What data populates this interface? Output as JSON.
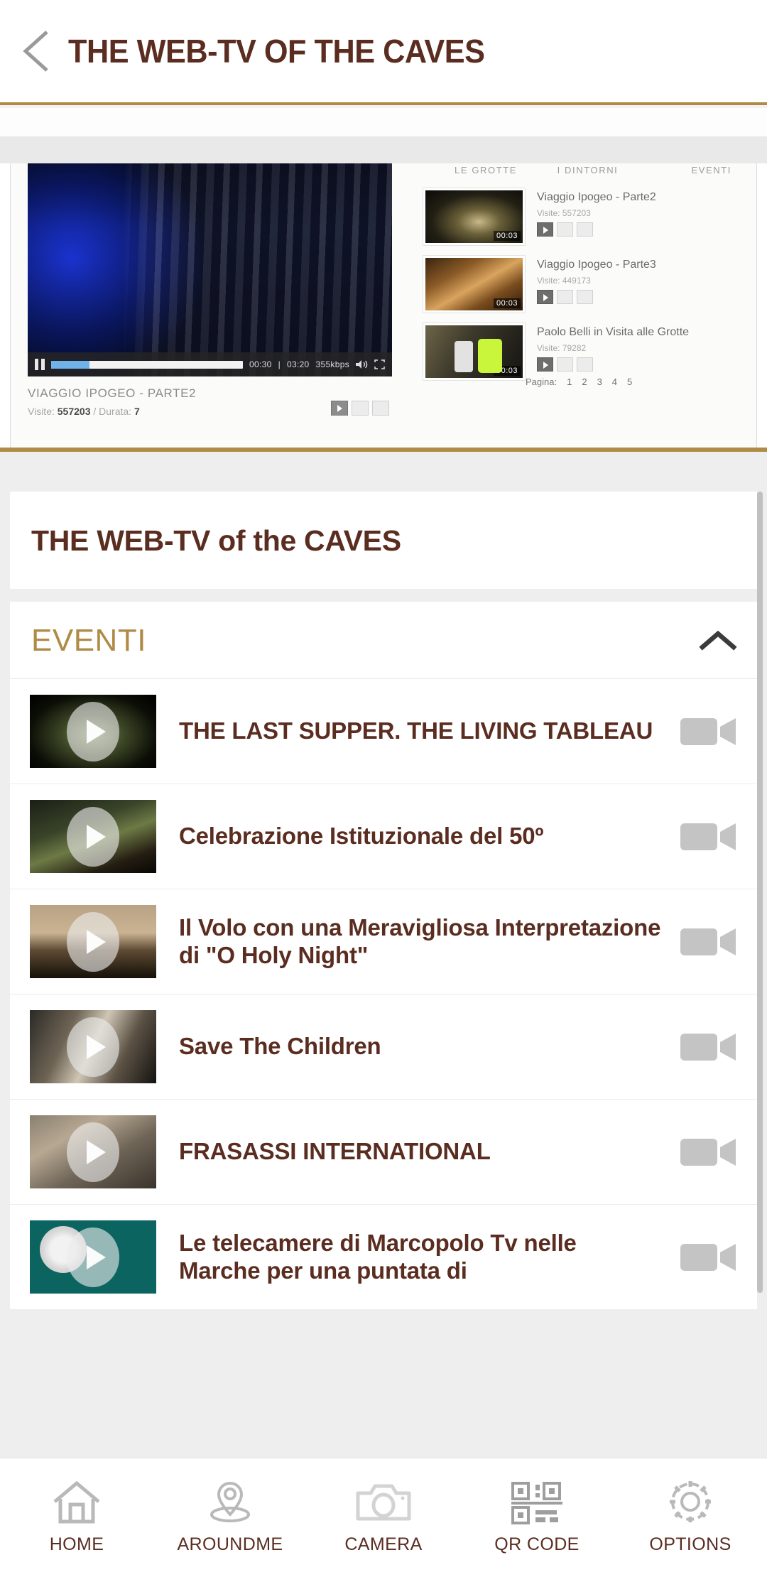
{
  "header": {
    "back_icon": "chevron-left-icon",
    "title": "THE WEB-TV OF THE CAVES"
  },
  "webview": {
    "player": {
      "pause_icon": "pause-icon",
      "time_current": "00:30",
      "time_separator": "|",
      "time_total": "03:20",
      "bitrate": "355kbps",
      "volume_icon": "volume-icon",
      "fullscreen_icon": "fullscreen-icon",
      "caption_title": "VIAGGIO IPOGEO - PARTE2",
      "caption_visits_label": "Visite:",
      "caption_visits_value": "557203",
      "caption_sep": "/",
      "caption_duration_label": "Durata:",
      "caption_duration_value": "7"
    },
    "tabs": [
      "LE GROTTE",
      "I DINTORNI",
      "EVENTI"
    ],
    "playlist": [
      {
        "title": "Viaggio Ipogeo - Parte2",
        "visits": "Visite: 557203",
        "duration": "00:03"
      },
      {
        "title": "Viaggio Ipogeo - Parte3",
        "visits": "Visite: 449173",
        "duration": "00:03"
      },
      {
        "title": "Paolo Belli in Visita alle Grotte",
        "visits": "Visite: 79282",
        "duration": "00:03"
      }
    ],
    "pager_label": "Pagina:",
    "pager_pages": [
      "1",
      "2",
      "3",
      "4",
      "5"
    ]
  },
  "collapse_tab": {
    "icon": "chevron-up-icon"
  },
  "section": {
    "card_title": "THE WEB-TV of the CAVES",
    "accordion_title": "EVENTI",
    "accordion_chevron": "chevron-up-icon"
  },
  "videos": [
    {
      "title": "THE LAST SUPPER. THE LIVING TABLEAU",
      "play_icon": "play-icon",
      "action_icon": "video-camera-icon"
    },
    {
      "title": "Celebrazione Istituzionale del 50º",
      "play_icon": "play-icon",
      "action_icon": "video-camera-icon"
    },
    {
      "title": "Il Volo con una Meravigliosa Interpretazione di \"O Holy Night\"",
      "play_icon": "play-icon",
      "action_icon": "video-camera-icon"
    },
    {
      "title": "Save The Children",
      "play_icon": "play-icon",
      "action_icon": "video-camera-icon"
    },
    {
      "title": "FRASASSI INTERNATIONAL",
      "play_icon": "play-icon",
      "action_icon": "video-camera-icon"
    },
    {
      "title": "Le telecamere di Marcopolo Tv nelle Marche per una puntata di",
      "play_icon": "play-icon",
      "action_icon": "video-camera-icon"
    }
  ],
  "bottom_nav": [
    {
      "label": "HOME",
      "icon": "home-icon"
    },
    {
      "label": "AROUNDME",
      "icon": "map-pin-icon"
    },
    {
      "label": "CAMERA",
      "icon": "camera-icon"
    },
    {
      "label": "QR CODE",
      "icon": "qr-code-icon"
    },
    {
      "label": "OPTIONS",
      "icon": "gear-icon"
    }
  ],
  "colors": {
    "brand_brown": "#5a2d20",
    "brand_gold": "#b08b46",
    "page_bg": "#eeeeee",
    "icon_gray": "#bcbcbc"
  }
}
